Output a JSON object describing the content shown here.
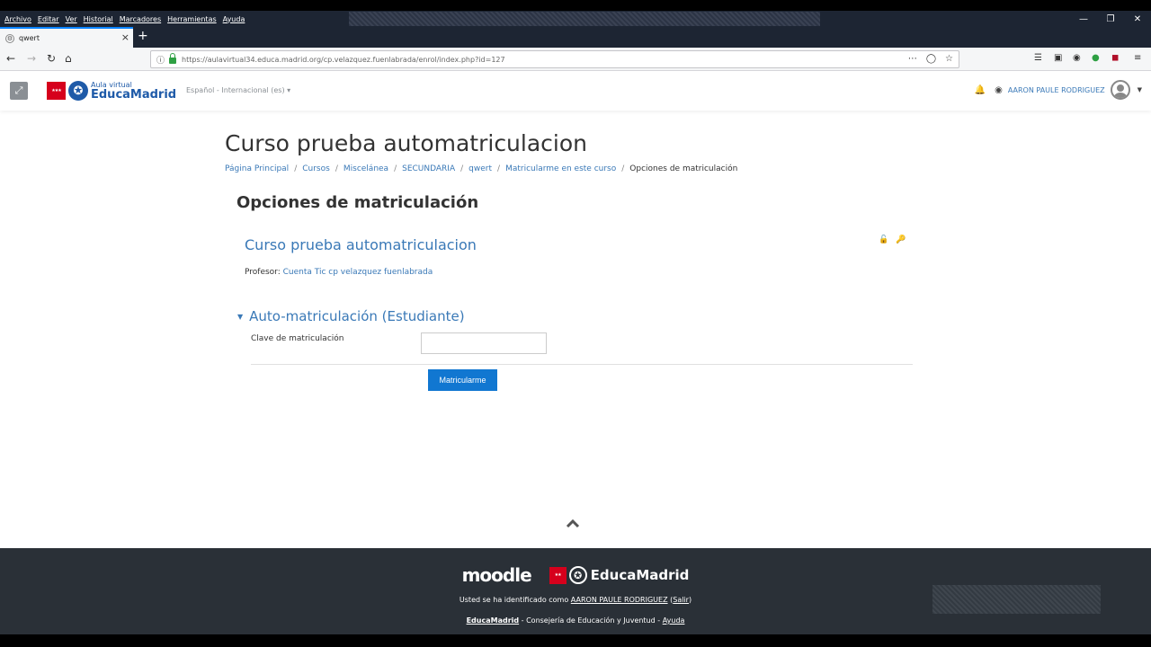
{
  "browser": {
    "menu": [
      "Archivo",
      "Editar",
      "Ver",
      "Historial",
      "Marcadores",
      "Herramientas",
      "Ayuda"
    ],
    "tab_title": "qwert",
    "url": "https://aulavirtual34.educa.madrid.org/cp.velazquez.fuenlabrada/enrol/index.php?id=127"
  },
  "header": {
    "brand_small": "Aula virtual",
    "brand_big": "EducaMadrid",
    "language": "Español - Internacional (es)",
    "user_name": "AARON PAULE RODRIGUEZ"
  },
  "page": {
    "title": "Curso prueba automatriculacion",
    "breadcrumb": [
      "Página Principal",
      "Cursos",
      "Miscelánea",
      "SECUNDARIA",
      "qwert",
      "Matricularme en este curso",
      "Opciones de matriculación"
    ],
    "section_title": "Opciones de matriculación",
    "course_title": "Curso prueba automatriculacion",
    "teacher_label": "Profesor: ",
    "teacher_name": "Cuenta Tic cp velazquez fuenlabrada",
    "fieldset_legend": "Auto-matriculación (Estudiante)",
    "key_label": "Clave de matriculación",
    "submit_label": "Matricularme"
  },
  "footer": {
    "moodle": "moodle",
    "educamadrid": "EducaMadrid",
    "login_prefix": "Usted se ha identificado como ",
    "login_user": "AARON PAULE RODRIGUEZ",
    "logout": "Salir",
    "credit_link": "EducaMadrid",
    "credit_text": " - Consejería de Educación y Juventud - ",
    "help": "Ayuda"
  },
  "colors": {
    "accent": "#1177d1",
    "link": "#3a79b7",
    "footer_bg": "#2a3037"
  }
}
